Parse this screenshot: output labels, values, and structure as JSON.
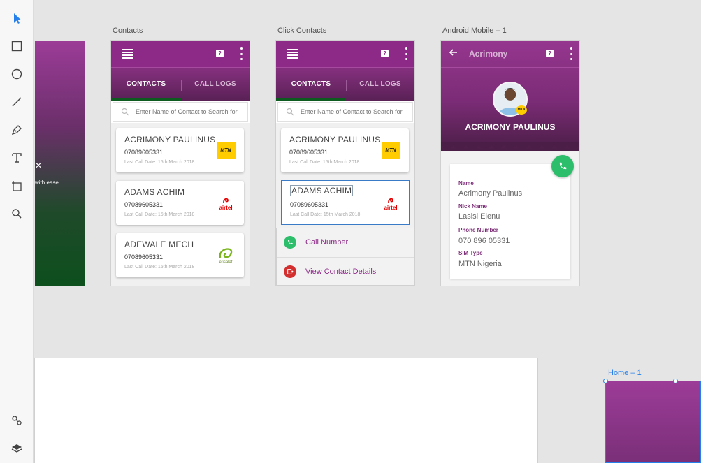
{
  "toolbar": {
    "tools": [
      {
        "name": "select-tool",
        "icon": "arrow-pointer-icon"
      },
      {
        "name": "rectangle-tool",
        "icon": "rectangle-icon"
      },
      {
        "name": "ellipse-tool",
        "icon": "ellipse-icon"
      },
      {
        "name": "line-tool",
        "icon": "line-icon"
      },
      {
        "name": "pen-tool",
        "icon": "pen-icon"
      },
      {
        "name": "text-tool",
        "icon": "text-icon"
      },
      {
        "name": "artboard-tool",
        "icon": "artboard-icon"
      },
      {
        "name": "zoom-tool",
        "icon": "zoom-icon"
      },
      {
        "name": "assets-tool",
        "icon": "assets-icon"
      },
      {
        "name": "layers-tool",
        "icon": "layers-icon"
      }
    ]
  },
  "partial_board": {
    "text": "with ease"
  },
  "contacts_board": {
    "label": "Contacts",
    "tabs": [
      "CONTACTS",
      "CALL LOGS"
    ],
    "search_placeholder": "Enter Name of Contact to Search for",
    "cards": [
      {
        "name": "ACRIMONY PAULINUS",
        "phone": "07089605331",
        "last_call": "Last Call Date: 15th March 2018",
        "network": "MTN"
      },
      {
        "name": "ADAMS ACHIM",
        "phone": "07089605331",
        "last_call": "Last Call Date: 15th March 2018",
        "network": "airtel"
      },
      {
        "name": "ADEWALE MECH",
        "phone": "07089605331",
        "last_call": "Last Call Date: 15th March 2018",
        "network": "etisalat"
      }
    ]
  },
  "click_contacts_board": {
    "label": "Click Contacts",
    "tabs": [
      "CONTACTS",
      "CALL LOGS"
    ],
    "search_placeholder": "Enter Name of Contact to Search for",
    "cards": [
      {
        "name": "ACRIMONY PAULINUS",
        "phone": "07089605331",
        "last_call": "Last Call Date: 15th March 2018",
        "network": "MTN"
      },
      {
        "name": "ADAMS ACHIM",
        "phone": "07089605331",
        "last_call": "Last Call Date: 15th March 2018",
        "network": "airtel"
      }
    ],
    "popup": {
      "call_label": "Call Number",
      "view_label": "View Contact Details"
    }
  },
  "android_board": {
    "label": "Android Mobile – 1",
    "title": "Acrimony",
    "contact_name": "ACRIMONY PAULINUS",
    "fields": [
      {
        "label": "Name",
        "value": "Acrimony Paulinus"
      },
      {
        "label": "Nick Name",
        "value": "Lasisi Elenu"
      },
      {
        "label": "Phone Number",
        "value": "070 896 05331"
      },
      {
        "label": "SIM Type",
        "value": "MTN Nigeria"
      }
    ]
  },
  "home_board": {
    "label": "Home – 1"
  },
  "colors": {
    "brand_purple": "#8d2a88",
    "brand_green": "#0e5b1f",
    "call_green": "#2dbe6c",
    "selection_blue": "#2680eb",
    "canvas": "#e5e5e5"
  }
}
